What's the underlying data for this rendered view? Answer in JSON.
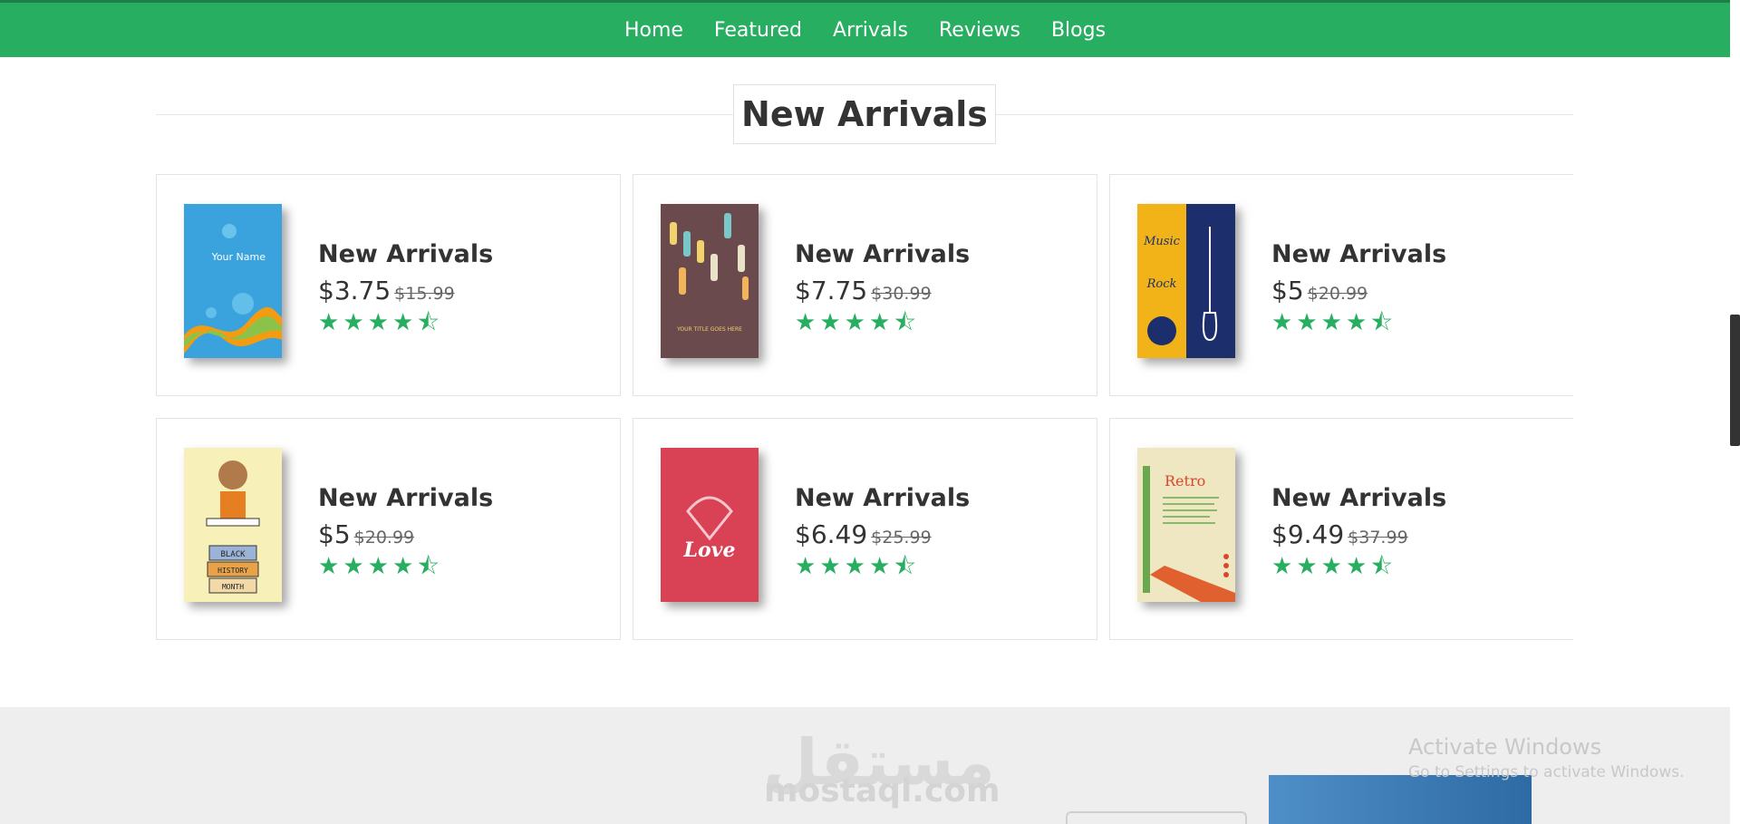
{
  "nav": {
    "links": [
      "Home",
      "Featured",
      "Arrivals",
      "Reviews",
      "Blogs"
    ]
  },
  "section": {
    "title": "New Arrivals"
  },
  "products": [
    {
      "name": "New Arrivals",
      "price": "$3.75",
      "old_price": "$15.99",
      "rating": 4.5
    },
    {
      "name": "New Arrivals",
      "price": "$7.75",
      "old_price": "$30.99",
      "rating": 4.5
    },
    {
      "name": "New Arrivals",
      "price": "$5",
      "old_price": "$20.99",
      "rating": 4.5
    },
    {
      "name": "New Arrivals",
      "price": "$5",
      "old_price": "$20.99",
      "rating": 4.5
    },
    {
      "name": "New Arrivals",
      "price": "$6.49",
      "old_price": "$25.99",
      "rating": 4.5
    },
    {
      "name": "New Arrivals",
      "price": "$9.49",
      "old_price": "$37.99",
      "rating": 4.5
    }
  ],
  "covers": {
    "c1": {
      "text": "Your Name"
    },
    "c2": {
      "text": "YOUR TITLE GOES HERE"
    },
    "c3": {
      "text1": "Music",
      "text2": "Rock"
    },
    "c4": {
      "text1": "BLACK",
      "text2": "HISTORY",
      "text3": "MONTH"
    },
    "c5": {
      "text": "Love"
    },
    "c6": {
      "text": "Retro"
    }
  },
  "footer": {
    "watermark_ar": "مستقل",
    "watermark_en": "mostaql.com",
    "windows_title": "Activate Windows",
    "windows_sub": "Go to Settings to activate Windows."
  },
  "colors": {
    "accent": "#27ae60"
  }
}
